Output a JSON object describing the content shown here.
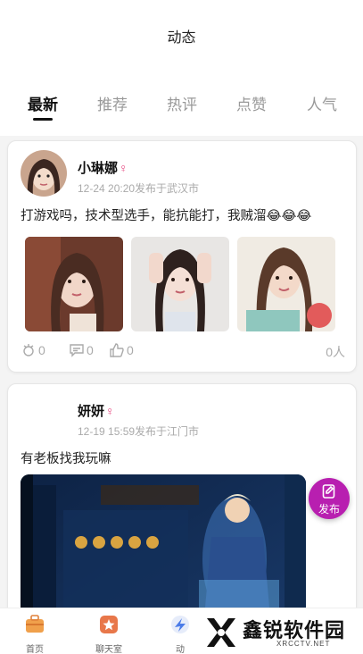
{
  "page_title": "动态",
  "tabs": [
    {
      "label": "最新",
      "active": true
    },
    {
      "label": "推荐",
      "active": false
    },
    {
      "label": "热评",
      "active": false
    },
    {
      "label": "点赞",
      "active": false
    },
    {
      "label": "人气",
      "active": false
    }
  ],
  "posts": [
    {
      "username": "小琳娜",
      "gender_symbol": "♀",
      "meta": "12-24 20:20发布于武汉市",
      "content": "打游戏吗，技术型选手，能抗能打，我贼溜😂😂😂",
      "photos": [
        "photo-girl-1",
        "photo-girl-2",
        "photo-girl-3"
      ],
      "gifts": "0",
      "comments": "0",
      "likes": "0",
      "views": "0人"
    },
    {
      "username": "妍妍",
      "gender_symbol": "♀",
      "meta": "12-19 15:59发布于江门市",
      "content": "有老板找我玩嘛",
      "photos": [
        "game-screenshot"
      ]
    }
  ],
  "publish_button": {
    "label": "发布",
    "icon": "edit-icon"
  },
  "bottom_nav": [
    {
      "label": "首页",
      "icon": "briefcase-icon",
      "color": "#f0a04b"
    },
    {
      "label": "聊天室",
      "icon": "star-icon",
      "color": "#e8774a"
    },
    {
      "label": "动",
      "icon": "feed-icon",
      "color": "#4a7be8"
    }
  ],
  "watermark": {
    "title": "鑫锐软件园",
    "subtitle": "XRCCTV.NET"
  },
  "colors": {
    "gender": "#e64980",
    "publish": "#b81fb0",
    "muted": "#aaaaaa"
  }
}
